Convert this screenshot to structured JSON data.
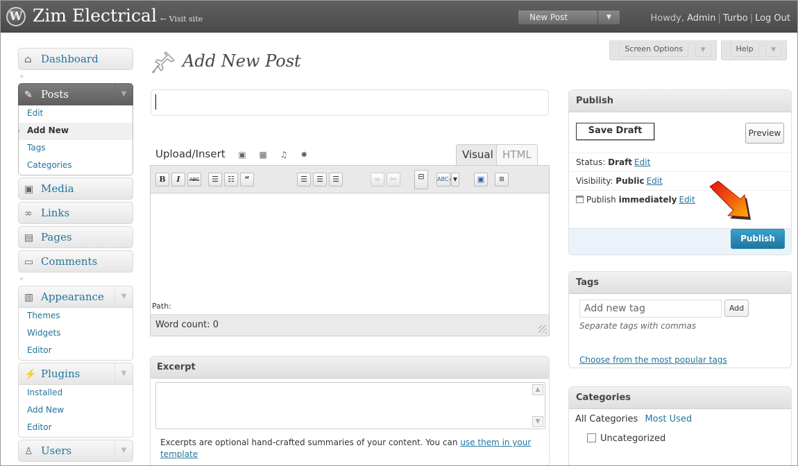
{
  "header": {
    "site_title": "Zim Electrical",
    "visit_site": "← Visit site",
    "favorite_action": "New Post",
    "greeting": "Howdy,",
    "user": "Admin",
    "turbo": "Turbo",
    "logout": "Log Out"
  },
  "screen_options": {
    "screen_options": "Screen Options",
    "help": "Help"
  },
  "sidebar": {
    "dashboard": "Dashboard",
    "posts": "Posts",
    "posts_items": [
      "Edit",
      "Add New",
      "Tags",
      "Categories"
    ],
    "media": "Media",
    "links": "Links",
    "pages": "Pages",
    "comments": "Comments",
    "appearance": "Appearance",
    "appearance_items": [
      "Themes",
      "Widgets",
      "Editor"
    ],
    "plugins": "Plugins",
    "plugins_items": [
      "Installed",
      "Add New",
      "Editor"
    ],
    "users": "Users"
  },
  "main": {
    "page_title": "Add New Post",
    "title_value": "",
    "upload_insert": "Upload/Insert",
    "tab_visual": "Visual",
    "tab_html": "HTML",
    "path_label": "Path:",
    "word_count": "Word count: 0"
  },
  "excerpt": {
    "heading": "Excerpt",
    "help_text": "Excerpts are optional hand-crafted summaries of your content. You can",
    "help_link": "use them in your template"
  },
  "publish": {
    "heading": "Publish",
    "save_draft": "Save Draft",
    "preview": "Preview",
    "status_label": "Status:",
    "status_value": "Draft",
    "visibility_label": "Visibility:",
    "visibility_value": "Public",
    "publish_label": "Publish",
    "publish_value": "immediately",
    "edit": "Edit",
    "publish_button": "Publish"
  },
  "tags": {
    "heading": "Tags",
    "placeholder": "Add new tag",
    "add": "Add",
    "help": "Separate tags with commas",
    "popular": "Choose from the most popular tags"
  },
  "categories": {
    "heading": "Categories",
    "tab_all": "All Categories",
    "tab_used": "Most Used",
    "items": [
      "Uncategorized"
    ]
  }
}
